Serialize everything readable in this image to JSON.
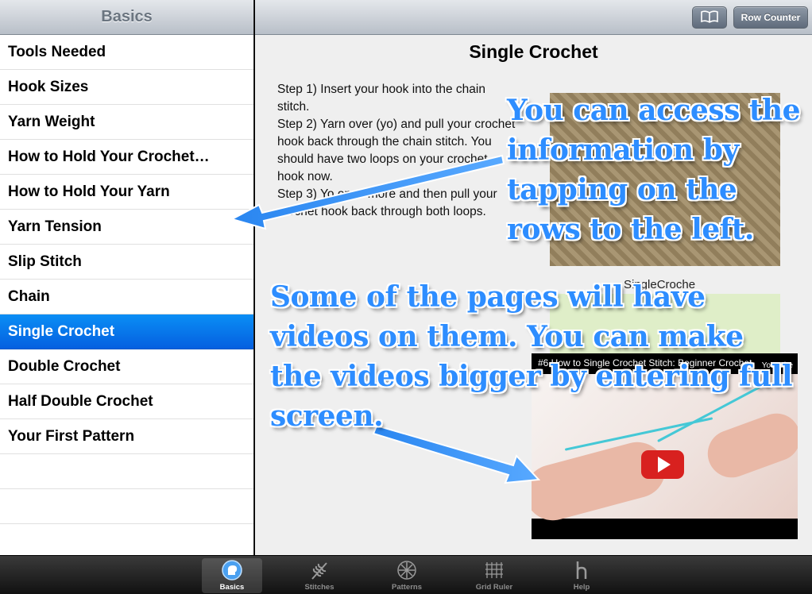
{
  "sidebar": {
    "title": "Basics",
    "items": [
      {
        "label": "Tools Needed"
      },
      {
        "label": "Hook Sizes"
      },
      {
        "label": "Yarn Weight"
      },
      {
        "label": "How to Hold Your Crochet…"
      },
      {
        "label": "How to Hold Your Yarn"
      },
      {
        "label": "Yarn Tension"
      },
      {
        "label": "Slip Stitch"
      },
      {
        "label": "Chain"
      },
      {
        "label": "Single Crochet",
        "selected": true
      },
      {
        "label": "Double Crochet"
      },
      {
        "label": "Half Double Crochet"
      },
      {
        "label": "Your First Pattern"
      }
    ]
  },
  "header": {
    "book_icon": "book-icon",
    "row_counter_label": "Row Counter"
  },
  "content": {
    "title": "Single Crochet",
    "steps_text": "Step 1) Insert your hook into the chain stitch.\nStep 2) Yarn over (yo) and pull your crochet hook back through the chain stitch. You should have two loops on your crochet hook now.\nStep 3) Yo once more and then pull your crochet hook back through both loops.",
    "photo_caption": "SingleCroche",
    "video": {
      "title": "#6 How to Single Crochet Stitch: Beginner Crochet",
      "brand": "YouTube",
      "play_icon": "play-icon"
    }
  },
  "overlays": {
    "callout_1": "You can access the information by tapping on the rows to the left.",
    "callout_2": "Some of the pages will have videos on them. You can make the videos bigger by entering full screen."
  },
  "tabs": [
    {
      "label": "Basics",
      "icon": "head-icon",
      "active": true
    },
    {
      "label": "Stitches",
      "icon": "wheat-icon"
    },
    {
      "label": "Patterns",
      "icon": "snowflake-icon"
    },
    {
      "label": "Grid Ruler",
      "icon": "grid-icon"
    },
    {
      "label": "Help",
      "icon": "help-h-icon"
    }
  ],
  "colors": {
    "selection": "#0a7cf0",
    "overlay_text": "#2d8dff"
  }
}
